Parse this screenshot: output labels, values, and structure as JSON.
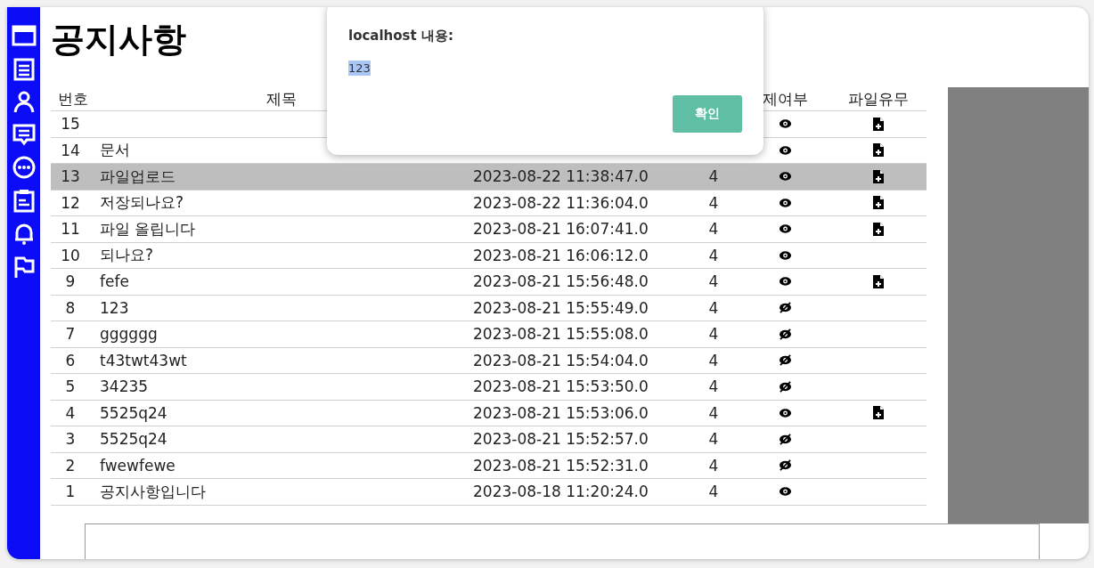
{
  "page": {
    "title": "공지사항"
  },
  "sidebar": {
    "items": [
      {
        "kind": "window"
      },
      {
        "kind": "list"
      },
      {
        "kind": "person"
      },
      {
        "kind": "chat"
      },
      {
        "kind": "dots"
      },
      {
        "kind": "clipboard"
      },
      {
        "kind": "bell"
      },
      {
        "kind": "flag"
      }
    ]
  },
  "table": {
    "columns": [
      "번호",
      "제목",
      "제여부",
      "파일유무"
    ],
    "rows": [
      {
        "number": "15",
        "title": "",
        "date": "",
        "count": "",
        "deleted": false,
        "has_file": true,
        "selected": false
      },
      {
        "number": "14",
        "title": "문서",
        "date": "",
        "count": "",
        "deleted": false,
        "has_file": true,
        "selected": false
      },
      {
        "number": "13",
        "title": "파일업로드",
        "date": "2023-08-22 11:38:47.0",
        "count": "4",
        "deleted": false,
        "has_file": true,
        "selected": true
      },
      {
        "number": "12",
        "title": "저장되나요?",
        "date": "2023-08-22 11:36:04.0",
        "count": "4",
        "deleted": false,
        "has_file": true,
        "selected": false
      },
      {
        "number": "11",
        "title": "파일 올립니다",
        "date": "2023-08-21 16:07:41.0",
        "count": "4",
        "deleted": false,
        "has_file": true,
        "selected": false
      },
      {
        "number": "10",
        "title": "되나요?",
        "date": "2023-08-21 16:06:12.0",
        "count": "4",
        "deleted": false,
        "has_file": false,
        "selected": false
      },
      {
        "number": "9",
        "title": "fefe",
        "date": "2023-08-21 15:56:48.0",
        "count": "4",
        "deleted": false,
        "has_file": true,
        "selected": false
      },
      {
        "number": "8",
        "title": "123",
        "date": "2023-08-21 15:55:49.0",
        "count": "4",
        "deleted": true,
        "has_file": false,
        "selected": false
      },
      {
        "number": "7",
        "title": "gggggg",
        "date": "2023-08-21 15:55:08.0",
        "count": "4",
        "deleted": true,
        "has_file": false,
        "selected": false
      },
      {
        "number": "6",
        "title": "t43twt43wt",
        "date": "2023-08-21 15:54:04.0",
        "count": "4",
        "deleted": true,
        "has_file": false,
        "selected": false
      },
      {
        "number": "5",
        "title": "34235",
        "date": "2023-08-21 15:53:50.0",
        "count": "4",
        "deleted": true,
        "has_file": false,
        "selected": false
      },
      {
        "number": "4",
        "title": "5525q24",
        "date": "2023-08-21 15:53:06.0",
        "count": "4",
        "deleted": false,
        "has_file": true,
        "selected": false
      },
      {
        "number": "3",
        "title": "5525q24",
        "date": "2023-08-21 15:52:57.0",
        "count": "4",
        "deleted": true,
        "has_file": false,
        "selected": false
      },
      {
        "number": "2",
        "title": "fwewfewe",
        "date": "2023-08-21 15:52:31.0",
        "count": "4",
        "deleted": true,
        "has_file": false,
        "selected": false
      },
      {
        "number": "1",
        "title": "공지사항입니다",
        "date": "2023-08-18 11:20:24.0",
        "count": "4",
        "deleted": false,
        "has_file": false,
        "selected": false
      }
    ]
  },
  "dialog": {
    "title": "localhost 내용:",
    "message": "123",
    "button": "확인"
  }
}
